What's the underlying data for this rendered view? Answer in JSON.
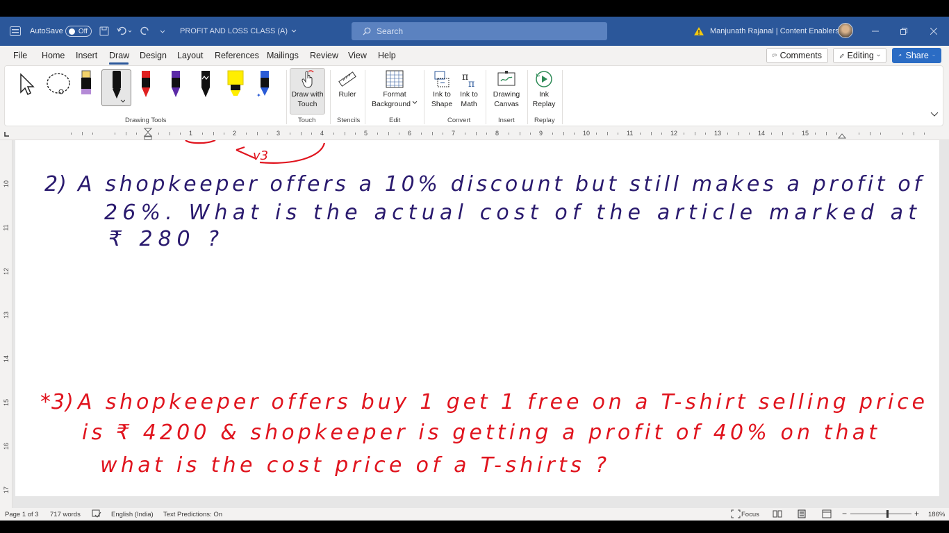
{
  "titlebar": {
    "autosave_label": "AutoSave",
    "autosave_state": "Off",
    "document_title": "PROFIT AND LOSS CLASS (A)",
    "search_placeholder": "Search",
    "user_name": "Manjunath Rajanal | Content Enablers",
    "accent_color": "#2b579a"
  },
  "menu": {
    "tabs": [
      "File",
      "Home",
      "Insert",
      "Draw",
      "Design",
      "Layout",
      "References",
      "Mailings",
      "Review",
      "View",
      "Help"
    ],
    "active_tab": "Draw",
    "comments_label": "Comments",
    "editing_label": "Editing",
    "share_label": "Share"
  },
  "ribbon": {
    "groups": {
      "drawing_tools": "Drawing Tools",
      "touch": "Touch",
      "stencils": "Stencils",
      "edit": "Edit",
      "convert": "Convert",
      "insert": "Insert",
      "replay": "Replay"
    },
    "buttons": {
      "draw_with_touch_1": "Draw with",
      "draw_with_touch_2": "Touch",
      "ruler": "Ruler",
      "format_background_1": "Format",
      "format_background_2": "Background",
      "ink_to_shape_1": "Ink to",
      "ink_to_shape_2": "Shape",
      "ink_to_math_1": "Ink to",
      "ink_to_math_2": "Math",
      "drawing_canvas_1": "Drawing",
      "drawing_canvas_2": "Canvas",
      "ink_replay_1": "Ink",
      "ink_replay_2": "Replay"
    },
    "pens": [
      {
        "icon": "highlighter-purple-icon",
        "color": "#b48ad6"
      },
      {
        "icon": "pen-black-icon",
        "color": "#111111"
      },
      {
        "icon": "pen-red-icon",
        "color": "#e02020"
      },
      {
        "icon": "pen-purple-icon",
        "color": "#5b2aa6"
      },
      {
        "icon": "pen-black-pattern-icon",
        "color": "#111111"
      },
      {
        "icon": "highlighter-yellow-icon",
        "color": "#ffee00"
      },
      {
        "icon": "pen-galaxy-icon",
        "color": "#2a5bd6"
      }
    ]
  },
  "ruler": {
    "numbers": [
      "1",
      "2",
      "3",
      "4",
      "5",
      "6",
      "7",
      "8",
      "9",
      "10",
      "11",
      "12",
      "13",
      "14",
      "15"
    ],
    "vertical_numbers": [
      "10",
      "11",
      "12",
      "13",
      "14",
      "15",
      "16",
      "17"
    ]
  },
  "document": {
    "fragment_top": "v3",
    "q2": {
      "number": "2)",
      "line1": "A shopkeeper offers a 10% discount but still makes a profit of",
      "line2": "26%. What is the actual cost of the article marked at",
      "line3": "₹ 280 ?",
      "ink_color": "#2a1a6e"
    },
    "q3": {
      "number": "*3)",
      "line1": "A shopkeeper offers buy 1 get 1 free on a T-shirt selling price",
      "line2": "is ₹ 4200 & shopkeeper is getting a profit of 40% on that",
      "line3": "what is the cost price of a T-shirts ?",
      "ink_color": "#e0141e"
    }
  },
  "statusbar": {
    "page": "Page 1 of 3",
    "words": "717 words",
    "language": "English (India)",
    "text_predictions": "Text Predictions: On",
    "focus": "Focus",
    "zoom": "186%"
  }
}
